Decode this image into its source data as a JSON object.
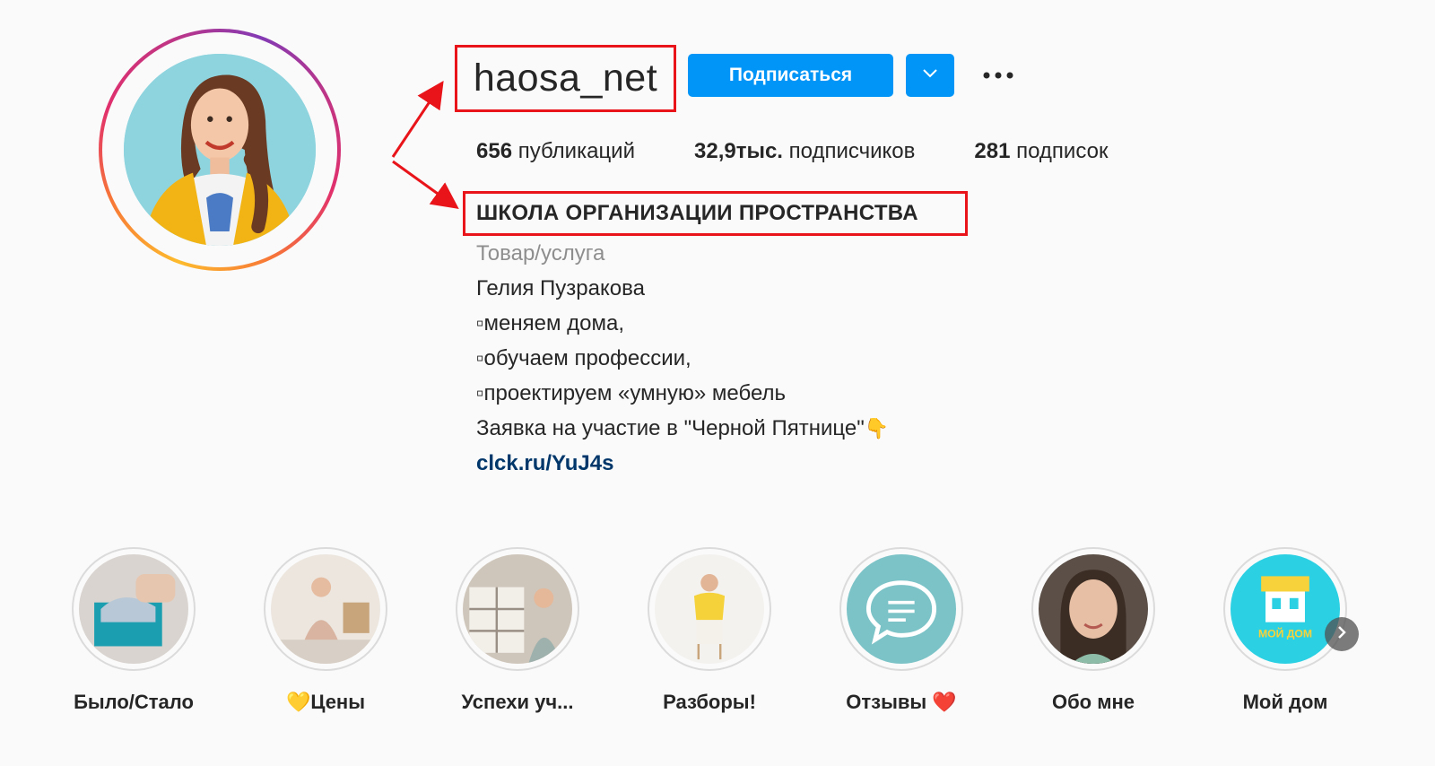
{
  "profile": {
    "username": "haosa_net",
    "follow_label": "Подписаться",
    "stats": {
      "posts_value": "656",
      "posts_label": "публикаций",
      "followers_value": "32,9тыс.",
      "followers_label": "подписчиков",
      "following_value": "281",
      "following_label": "подписок"
    },
    "full_name": "ШКОЛА ОРГАНИЗАЦИИ ПРОСТРАНСТВА",
    "category": "Товар/услуга",
    "bio_lines": [
      "Гелия Пузракова",
      "▫меняем дома,",
      "▫обучаем профессии,",
      "▫проектируем «умную» мебель",
      "Заявка на участие в \"Черной Пятнице\""
    ],
    "bio_emoji": "👇",
    "link": "clck.ru/YuJ4s"
  },
  "highlights": [
    {
      "label": "Было/Стало",
      "icon": "box-clothes-photo"
    },
    {
      "label": "💛Цены",
      "icon": "woman-sitting-photo"
    },
    {
      "label": "Успехи уч...",
      "icon": "woman-shelves-photo"
    },
    {
      "label": "Разборы!",
      "icon": "woman-chair-photo"
    },
    {
      "label": "Отзывы ❤️",
      "icon": "chat-bubble-icon"
    },
    {
      "label": "Обо мне",
      "icon": "portrait-photo"
    },
    {
      "label": "Мой дом",
      "icon": "house-icon"
    }
  ],
  "highlight_house_text": "МОЙ ДОМ",
  "colors": {
    "accent": "#0095f6",
    "annotation_red": "#e8141a",
    "link": "#00376b"
  }
}
